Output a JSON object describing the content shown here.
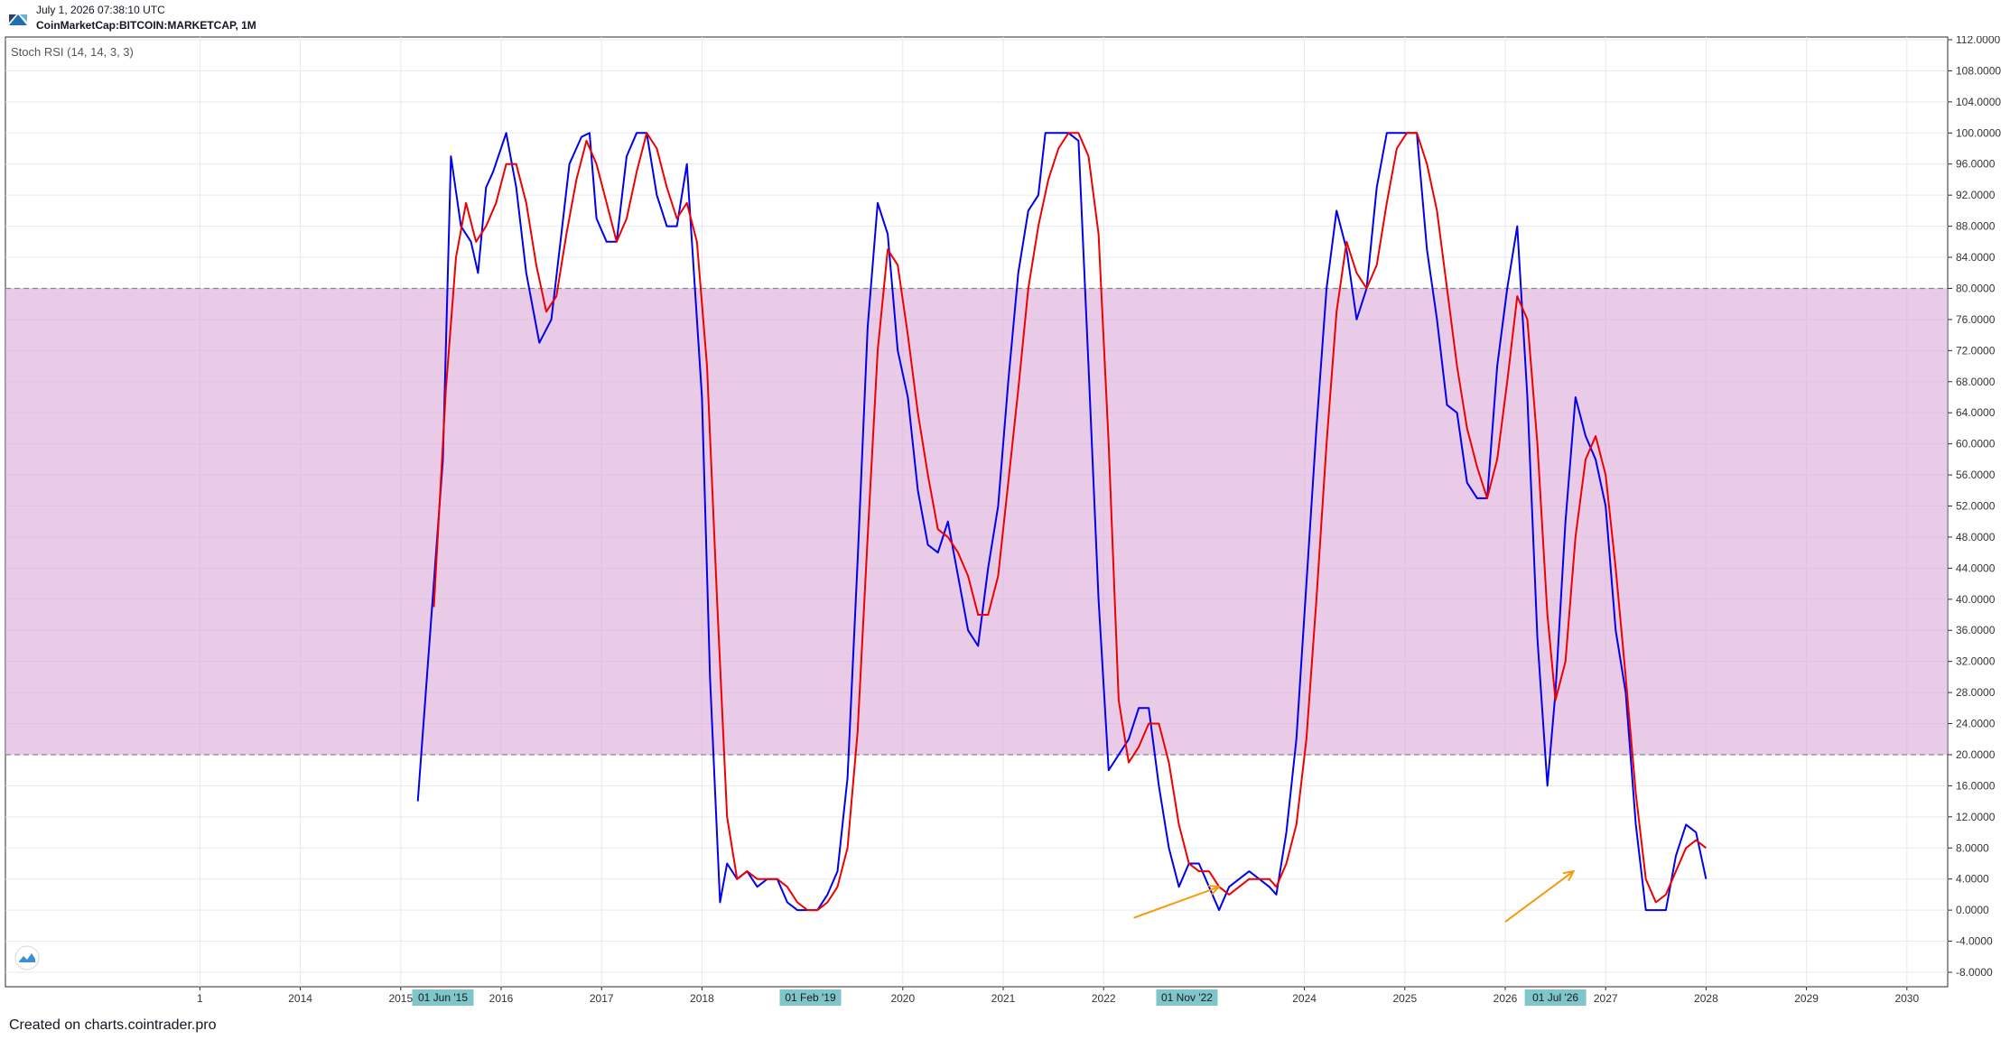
{
  "header": {
    "date": "July 1, 2026 07:38:10 UTC",
    "symbol": "CoinMarketCap:BITCOIN:MARKETCAP, 1M"
  },
  "footer": {
    "credit": "Created on charts.cointrader.pro"
  },
  "colors": {
    "k_line": "#0000ee",
    "d_line": "#ee0000",
    "band_fill": "#dba8d8",
    "band_line": "#888888",
    "arrow": "#f59a0b",
    "grid": "#e6e9ef",
    "axis_text": "#333333",
    "highlight": "#7fc6ca"
  },
  "chart_data": {
    "type": "line",
    "title": "Stoch RSI (14, 14, 3, 3)",
    "xlabel": "",
    "ylabel": "",
    "ylim": [
      -10,
      113
    ],
    "xlim": [
      2012.5,
      2031.3
    ],
    "grid": true,
    "y_ticks": [
      "112.0000",
      "108.0000",
      "104.0000",
      "100.0000",
      "96.0000",
      "92.0000",
      "88.0000",
      "84.0000",
      "80.0000",
      "76.0000",
      "72.0000",
      "68.0000",
      "64.0000",
      "60.0000",
      "56.0000",
      "52.0000",
      "48.0000",
      "44.0000",
      "40.0000",
      "36.0000",
      "32.0000",
      "28.0000",
      "24.0000",
      "20.0000",
      "16.0000",
      "12.0000",
      "8.0000",
      "4.0000",
      "0.0000",
      "-4.0000",
      "-8.0000"
    ],
    "x_ticks": [
      {
        "label": "1",
        "x": 2013.0
      },
      {
        "label": "2014",
        "x": 2014.0
      },
      {
        "label": "2015",
        "x": 2015.0
      },
      {
        "label": "2016",
        "x": 2016.0
      },
      {
        "label": "2017",
        "x": 2017.0
      },
      {
        "label": "2018",
        "x": 2018.0
      },
      {
        "label": "2020",
        "x": 2020.0
      },
      {
        "label": "2021",
        "x": 2021.0
      },
      {
        "label": "2022",
        "x": 2022.0
      },
      {
        "label": "2024",
        "x": 2024.0
      },
      {
        "label": "2025",
        "x": 2025.0
      },
      {
        "label": "2026",
        "x": 2026.0
      },
      {
        "label": "2027",
        "x": 2027.0
      },
      {
        "label": "2028",
        "x": 2028.0
      },
      {
        "label": "2029",
        "x": 2029.0
      },
      {
        "label": "2030",
        "x": 2030.0
      }
    ],
    "x_highlights": [
      {
        "label": "01 Jun '15",
        "x": 2015.42
      },
      {
        "label": "01 Feb '19",
        "x": 2019.08
      },
      {
        "label": "01 Nov '22",
        "x": 2022.83
      },
      {
        "label": "01 Jul '26",
        "x": 2026.5
      }
    ],
    "bands": [
      {
        "from": 20,
        "to": 80
      }
    ],
    "annotations": [
      {
        "type": "arrow",
        "from": [
          2022.3,
          -1
        ],
        "to": [
          2023.15,
          3
        ]
      },
      {
        "type": "arrow",
        "from": [
          2026.0,
          -1.5
        ],
        "to": [
          2026.68,
          5
        ]
      }
    ],
    "series": [
      {
        "key": "k",
        "points": [
          [
            2015.17,
            14
          ],
          [
            2015.42,
            58
          ],
          [
            2015.5,
            97
          ],
          [
            2015.6,
            88
          ],
          [
            2015.7,
            86
          ],
          [
            2015.77,
            82
          ],
          [
            2015.85,
            93
          ],
          [
            2015.92,
            95
          ],
          [
            2016.05,
            100
          ],
          [
            2016.15,
            93
          ],
          [
            2016.25,
            82
          ],
          [
            2016.38,
            73
          ],
          [
            2016.5,
            76
          ],
          [
            2016.6,
            87
          ],
          [
            2016.68,
            96
          ],
          [
            2016.8,
            99.5
          ],
          [
            2016.88,
            100
          ],
          [
            2016.95,
            89
          ],
          [
            2017.05,
            86
          ],
          [
            2017.15,
            86
          ],
          [
            2017.25,
            97
          ],
          [
            2017.35,
            100
          ],
          [
            2017.45,
            100
          ],
          [
            2017.55,
            92
          ],
          [
            2017.65,
            88
          ],
          [
            2017.75,
            88
          ],
          [
            2017.85,
            96
          ],
          [
            2018.0,
            66
          ],
          [
            2018.08,
            30
          ],
          [
            2018.18,
            1
          ],
          [
            2018.25,
            6
          ],
          [
            2018.35,
            4
          ],
          [
            2018.45,
            5
          ],
          [
            2018.55,
            3
          ],
          [
            2018.65,
            4
          ],
          [
            2018.75,
            4
          ],
          [
            2018.85,
            1
          ],
          [
            2018.95,
            0
          ],
          [
            2019.05,
            0
          ],
          [
            2019.15,
            0
          ],
          [
            2019.25,
            2
          ],
          [
            2019.35,
            5
          ],
          [
            2019.45,
            17
          ],
          [
            2019.55,
            45
          ],
          [
            2019.65,
            75
          ],
          [
            2019.75,
            91
          ],
          [
            2019.85,
            87
          ],
          [
            2019.95,
            72
          ],
          [
            2020.05,
            66
          ],
          [
            2020.15,
            54
          ],
          [
            2020.25,
            47
          ],
          [
            2020.35,
            46
          ],
          [
            2020.45,
            50
          ],
          [
            2020.55,
            43
          ],
          [
            2020.65,
            36
          ],
          [
            2020.75,
            34
          ],
          [
            2020.85,
            44
          ],
          [
            2020.95,
            52
          ],
          [
            2021.05,
            68
          ],
          [
            2021.15,
            82
          ],
          [
            2021.25,
            90
          ],
          [
            2021.35,
            92
          ],
          [
            2021.42,
            100
          ],
          [
            2021.5,
            100
          ],
          [
            2021.58,
            100
          ],
          [
            2021.65,
            100
          ],
          [
            2021.75,
            99
          ],
          [
            2021.85,
            70
          ],
          [
            2021.95,
            40
          ],
          [
            2022.05,
            18
          ],
          [
            2022.15,
            20
          ],
          [
            2022.25,
            22
          ],
          [
            2022.35,
            26
          ],
          [
            2022.45,
            26
          ],
          [
            2022.55,
            16
          ],
          [
            2022.65,
            8
          ],
          [
            2022.75,
            3
          ],
          [
            2022.85,
            6
          ],
          [
            2022.95,
            6
          ],
          [
            2023.05,
            3
          ],
          [
            2023.15,
            0
          ],
          [
            2023.25,
            3
          ],
          [
            2023.35,
            4
          ],
          [
            2023.45,
            5
          ],
          [
            2023.55,
            4
          ],
          [
            2023.65,
            3
          ],
          [
            2023.72,
            2
          ],
          [
            2023.82,
            10
          ],
          [
            2023.92,
            22
          ],
          [
            2024.02,
            42
          ],
          [
            2024.12,
            62
          ],
          [
            2024.22,
            80
          ],
          [
            2024.32,
            90
          ],
          [
            2024.42,
            85
          ],
          [
            2024.52,
            76
          ],
          [
            2024.62,
            80
          ],
          [
            2024.72,
            93
          ],
          [
            2024.82,
            100
          ],
          [
            2024.92,
            100
          ],
          [
            2025.02,
            100
          ],
          [
            2025.12,
            100
          ],
          [
            2025.22,
            85
          ],
          [
            2025.32,
            76
          ],
          [
            2025.42,
            65
          ],
          [
            2025.52,
            64
          ],
          [
            2025.62,
            55
          ],
          [
            2025.72,
            53
          ],
          [
            2025.82,
            53
          ],
          [
            2025.92,
            70
          ],
          [
            2026.02,
            80
          ],
          [
            2026.12,
            88
          ],
          [
            2026.22,
            66
          ],
          [
            2026.32,
            35
          ],
          [
            2026.42,
            16
          ],
          [
            2026.5,
            28
          ],
          [
            2026.6,
            50
          ],
          [
            2026.7,
            66
          ],
          [
            2026.8,
            61
          ],
          [
            2026.9,
            58
          ],
          [
            2027.0,
            52
          ],
          [
            2027.1,
            36
          ],
          [
            2027.2,
            28
          ],
          [
            2027.3,
            11
          ],
          [
            2027.4,
            0
          ],
          [
            2027.5,
            0
          ],
          [
            2027.6,
            0
          ],
          [
            2027.7,
            7
          ],
          [
            2027.8,
            11
          ],
          [
            2027.9,
            10
          ],
          [
            2028.0,
            4
          ]
        ]
      },
      {
        "key": "d",
        "points": [
          [
            2015.33,
            39
          ],
          [
            2015.45,
            67
          ],
          [
            2015.55,
            84
          ],
          [
            2015.65,
            91
          ],
          [
            2015.75,
            86
          ],
          [
            2015.85,
            88
          ],
          [
            2015.95,
            91
          ],
          [
            2016.05,
            96
          ],
          [
            2016.15,
            96
          ],
          [
            2016.25,
            91
          ],
          [
            2016.35,
            83
          ],
          [
            2016.45,
            77
          ],
          [
            2016.55,
            79
          ],
          [
            2016.65,
            87
          ],
          [
            2016.75,
            94
          ],
          [
            2016.85,
            99
          ],
          [
            2016.95,
            96
          ],
          [
            2017.05,
            91
          ],
          [
            2017.15,
            86
          ],
          [
            2017.25,
            89
          ],
          [
            2017.35,
            95
          ],
          [
            2017.45,
            100
          ],
          [
            2017.55,
            98
          ],
          [
            2017.65,
            93
          ],
          [
            2017.75,
            89
          ],
          [
            2017.85,
            91
          ],
          [
            2017.95,
            86
          ],
          [
            2018.05,
            70
          ],
          [
            2018.15,
            40
          ],
          [
            2018.25,
            12
          ],
          [
            2018.35,
            4
          ],
          [
            2018.45,
            5
          ],
          [
            2018.55,
            4
          ],
          [
            2018.65,
            4
          ],
          [
            2018.75,
            4
          ],
          [
            2018.85,
            3
          ],
          [
            2018.95,
            1
          ],
          [
            2019.05,
            0
          ],
          [
            2019.15,
            0
          ],
          [
            2019.25,
            1
          ],
          [
            2019.35,
            3
          ],
          [
            2019.45,
            8
          ],
          [
            2019.55,
            23
          ],
          [
            2019.65,
            48
          ],
          [
            2019.75,
            72
          ],
          [
            2019.85,
            85
          ],
          [
            2019.95,
            83
          ],
          [
            2020.05,
            74
          ],
          [
            2020.15,
            64
          ],
          [
            2020.25,
            56
          ],
          [
            2020.35,
            49
          ],
          [
            2020.45,
            48
          ],
          [
            2020.55,
            46
          ],
          [
            2020.65,
            43
          ],
          [
            2020.75,
            38
          ],
          [
            2020.85,
            38
          ],
          [
            2020.95,
            43
          ],
          [
            2021.05,
            55
          ],
          [
            2021.15,
            67
          ],
          [
            2021.25,
            80
          ],
          [
            2021.35,
            88
          ],
          [
            2021.45,
            94
          ],
          [
            2021.55,
            98
          ],
          [
            2021.65,
            100
          ],
          [
            2021.75,
            100
          ],
          [
            2021.85,
            97
          ],
          [
            2021.95,
            87
          ],
          [
            2022.05,
            60
          ],
          [
            2022.15,
            27
          ],
          [
            2022.25,
            19
          ],
          [
            2022.35,
            21
          ],
          [
            2022.45,
            24
          ],
          [
            2022.55,
            24
          ],
          [
            2022.65,
            19
          ],
          [
            2022.75,
            11
          ],
          [
            2022.85,
            6
          ],
          [
            2022.95,
            5
          ],
          [
            2023.05,
            5
          ],
          [
            2023.15,
            3
          ],
          [
            2023.25,
            2
          ],
          [
            2023.35,
            3
          ],
          [
            2023.45,
            4
          ],
          [
            2023.55,
            4
          ],
          [
            2023.65,
            4
          ],
          [
            2023.72,
            3
          ],
          [
            2023.82,
            6
          ],
          [
            2023.92,
            11
          ],
          [
            2024.02,
            22
          ],
          [
            2024.12,
            40
          ],
          [
            2024.22,
            60
          ],
          [
            2024.32,
            77
          ],
          [
            2024.42,
            86
          ],
          [
            2024.52,
            82
          ],
          [
            2024.62,
            80
          ],
          [
            2024.72,
            83
          ],
          [
            2024.82,
            91
          ],
          [
            2024.92,
            98
          ],
          [
            2025.02,
            100
          ],
          [
            2025.12,
            100
          ],
          [
            2025.22,
            96
          ],
          [
            2025.32,
            90
          ],
          [
            2025.42,
            80
          ],
          [
            2025.52,
            70
          ],
          [
            2025.62,
            62
          ],
          [
            2025.72,
            57
          ],
          [
            2025.82,
            53
          ],
          [
            2025.92,
            58
          ],
          [
            2026.02,
            68
          ],
          [
            2026.12,
            79
          ],
          [
            2026.22,
            76
          ],
          [
            2026.32,
            60
          ],
          [
            2026.42,
            38
          ],
          [
            2026.5,
            27
          ],
          [
            2026.6,
            32
          ],
          [
            2026.7,
            48
          ],
          [
            2026.8,
            58
          ],
          [
            2026.9,
            61
          ],
          [
            2027.0,
            56
          ],
          [
            2027.1,
            44
          ],
          [
            2027.2,
            30
          ],
          [
            2027.3,
            15
          ],
          [
            2027.4,
            4
          ],
          [
            2027.5,
            1
          ],
          [
            2027.6,
            2
          ],
          [
            2027.7,
            5
          ],
          [
            2027.8,
            8
          ],
          [
            2027.9,
            9
          ],
          [
            2028.0,
            8
          ]
        ]
      }
    ]
  }
}
